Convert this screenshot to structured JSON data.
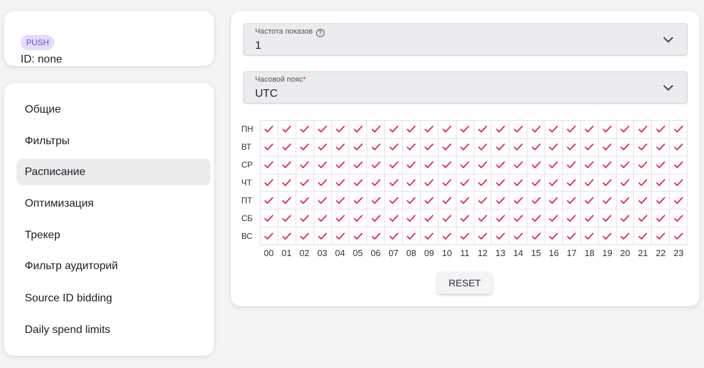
{
  "header_card": {
    "badge": "PUSH",
    "id_text": "ID: none"
  },
  "nav": {
    "items": [
      {
        "label": "Общие",
        "active": false
      },
      {
        "label": "Фильтры",
        "active": false
      },
      {
        "label": "Расписание",
        "active": true
      },
      {
        "label": "Оптимизация",
        "active": false
      },
      {
        "label": "Трекер",
        "active": false
      },
      {
        "label": "Фильтр аудиторий",
        "active": false
      },
      {
        "label": "Source ID bidding",
        "active": false
      },
      {
        "label": "Daily spend limits",
        "active": false
      }
    ]
  },
  "frequency_select": {
    "label": "Частота показов",
    "value": "1",
    "help_icon": "question-circle-icon"
  },
  "timezone_select": {
    "label": "Часовой пояс",
    "required_mark": "*",
    "value": "UTC"
  },
  "schedule": {
    "days": [
      "ПН",
      "ВТ",
      "СР",
      "ЧТ",
      "ПТ",
      "СБ",
      "ВС"
    ],
    "hours": [
      "00",
      "01",
      "02",
      "03",
      "04",
      "05",
      "06",
      "07",
      "08",
      "09",
      "10",
      "11",
      "12",
      "13",
      "14",
      "15",
      "16",
      "17",
      "18",
      "19",
      "20",
      "21",
      "22",
      "23"
    ],
    "all_checked": true,
    "check_icon": "checkmark-icon",
    "check_color": "#e0234e"
  },
  "reset_button": {
    "label": "RESET"
  },
  "colors": {
    "badge_bg": "#e6dbff",
    "badge_text": "#6a4cc0",
    "active_nav_bg": "#ececee",
    "select_bg": "#ebebf0",
    "required": "#e0234e"
  }
}
